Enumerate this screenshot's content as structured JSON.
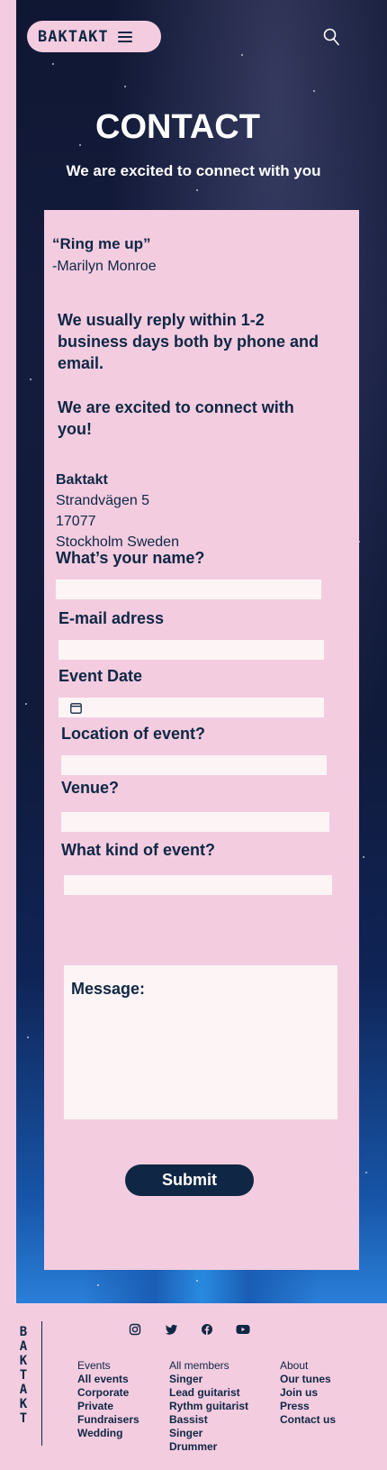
{
  "header": {
    "logo": "BAKTAKT",
    "title": "CONTACT",
    "subtitle": "We are excited to connect with you"
  },
  "contact": {
    "quote": "“Ring me up”",
    "quote_author": "-Marilyn Monroe",
    "reply_text": "We usually reply within 1-2 business days both by phone and email.",
    "excited_text": "We are excited to connect with you!",
    "address": {
      "name": "Baktakt",
      "street": "Strandvägen 5",
      "postal": "17077",
      "city": "Stockholm Sweden"
    }
  },
  "form": {
    "name_label": "What’s your name?",
    "email_label": "E-mail adress",
    "date_label": "Event Date",
    "location_label": "Location of event?",
    "venue_label": "Venue?",
    "kind_label": "What kind of event?",
    "message_label": "Message:",
    "submit_label": "Submit"
  },
  "footer": {
    "vertical_logo": [
      "B",
      "A",
      "K",
      "T",
      "A",
      "K",
      "T"
    ],
    "social_icons": [
      "instagram-icon",
      "twitter-icon",
      "facebook-icon",
      "youtube-icon"
    ],
    "events": {
      "heading": "Events",
      "links": [
        "All events",
        "Corporate",
        "Private",
        "Fundraisers",
        "Wedding"
      ]
    },
    "members": {
      "heading": "All members",
      "links": [
        "Singer",
        "Lead guitarist",
        "Rythm guitarist",
        "Bassist",
        "Singer",
        "Drummer"
      ]
    },
    "about": {
      "heading": "About",
      "links": [
        "Our tunes",
        "Join us",
        "Press",
        "Contact us"
      ]
    }
  },
  "colors": {
    "navy": "#0f2744",
    "pink": "#f3cce0",
    "field": "#fdf4f6"
  }
}
